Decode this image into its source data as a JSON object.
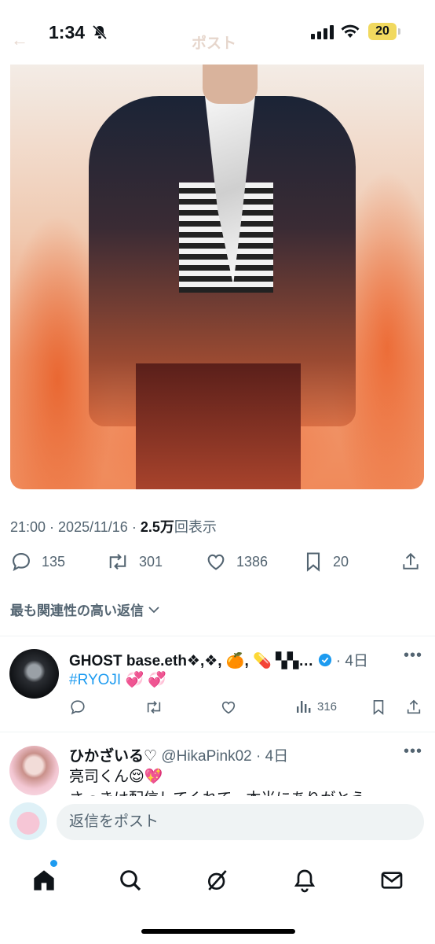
{
  "status_bar": {
    "time": "1:34",
    "battery": "20"
  },
  "nav": {
    "title": "ポスト"
  },
  "post": {
    "time": "21:00",
    "date": "2025/11/16",
    "views_count": "2.5万",
    "views_label": "回表示",
    "reply_count": "135",
    "repost_count": "301",
    "like_count": "1386",
    "bookmark_count": "20"
  },
  "replies_filter": {
    "label": "最も関連性の高い返信"
  },
  "replies": [
    {
      "name": "GHOST base.eth❖,❖",
      "name_tail": ", ",
      "time": "4日",
      "text": "#RYOJI 💞 💞",
      "views": "316"
    },
    {
      "name": "ひかざいる♡",
      "handle": "@HikaPink02",
      "time": "4日",
      "text": "亮司くん😌💖",
      "text2": "さっきは配信してくれて、本当にありがとう"
    }
  ],
  "compose": {
    "placeholder": "返信をポスト"
  },
  "colors": {
    "accent": "#1d9bf0",
    "secondary": "#536471",
    "text": "#0f1419"
  }
}
